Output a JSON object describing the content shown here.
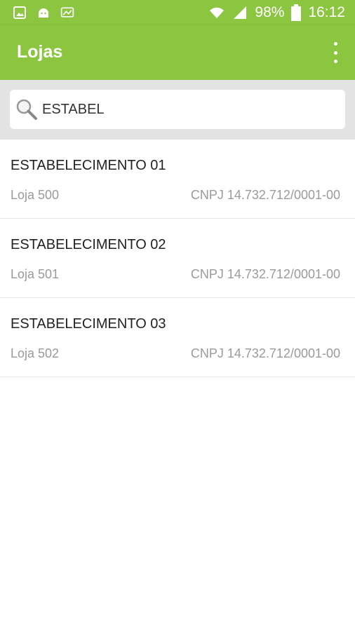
{
  "status_bar": {
    "icons_left": [
      "gallery-icon",
      "android-icon",
      "cast-icon"
    ],
    "battery": "98%",
    "time": "16:12"
  },
  "app_bar": {
    "title": "Lojas",
    "menu_icon": "more-vertical-icon"
  },
  "search": {
    "value": "ESTABEL",
    "icon": "search-icon"
  },
  "stores": [
    {
      "name": "ESTABELECIMENTO 01",
      "store": "Loja 500",
      "cnpj": "CNPJ 14.732.712/0001-00"
    },
    {
      "name": "ESTABELECIMENTO 02",
      "store": "Loja 501",
      "cnpj": "CNPJ 14.732.712/0001-00"
    },
    {
      "name": "ESTABELECIMENTO 03",
      "store": "Loja 502",
      "cnpj": "CNPJ 14.732.712/0001-00"
    }
  ],
  "colors": {
    "primary": "#8cc540",
    "search_band": "#e3e3e3",
    "secondary_text": "#9a9a9a"
  }
}
